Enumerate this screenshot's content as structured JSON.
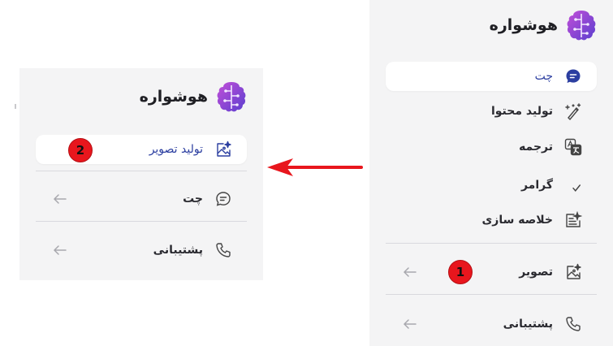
{
  "right_panel": {
    "logo_text": "هوشواره",
    "items": [
      {
        "label": "چت",
        "icon": "chat-bubble-icon",
        "active": true
      },
      {
        "label": "تولید محتوا",
        "icon": "magic-pen-icon"
      },
      {
        "label": "ترجمه",
        "icon": "translate-icon"
      },
      {
        "label": "گرامر",
        "icon": "abc-check-icon"
      },
      {
        "label": "خلاصه سازی",
        "icon": "document-sparkle-icon"
      },
      {
        "label": "تصویر",
        "icon": "image-sparkle-icon",
        "badge": "1"
      },
      {
        "label": "پشتیبانی",
        "icon": "phone-icon"
      }
    ]
  },
  "left_panel": {
    "logo_text": "هوشواره",
    "items": [
      {
        "label": "تولید تصویر",
        "icon": "image-sparkle-icon",
        "active": true,
        "badge": "2"
      },
      {
        "label": "چت",
        "icon": "chat-outline-icon"
      },
      {
        "label": "پشتیبانی",
        "icon": "phone-icon"
      }
    ]
  },
  "annotation": {
    "arrow_color": "#e8161d",
    "badge_color": "#e8161d"
  },
  "colors": {
    "brand": "#7b4fd6",
    "active_text": "#2b3ea0",
    "panel_bg": "#f4f4f5"
  }
}
